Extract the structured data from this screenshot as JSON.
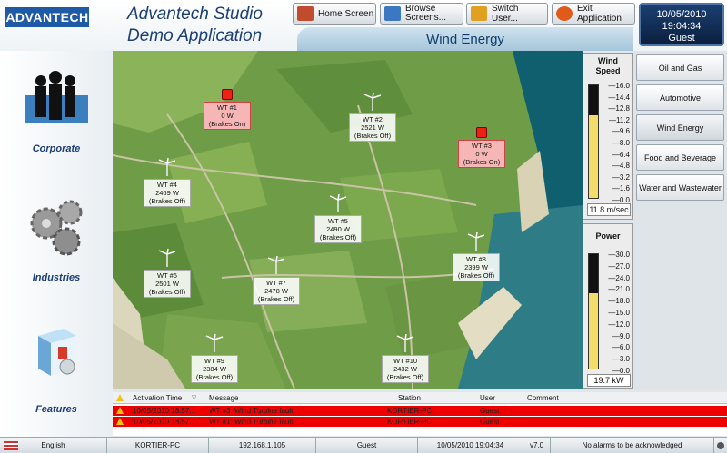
{
  "header": {
    "logo": "ADVANTECH",
    "title_line1": "Advantech Studio",
    "title_line2": "Demo Application",
    "buttons": [
      "Home Screen",
      "Browse Screens...",
      "Switch User...",
      "Exit Application"
    ],
    "screen_title": "Wind Energy",
    "date": "10/05/2010",
    "time": "19:04:34",
    "user": "Guest"
  },
  "left_nav": [
    {
      "label": "Corporate",
      "icon": "people-icon"
    },
    {
      "label": "Industries",
      "icon": "gears-icon"
    },
    {
      "label": "Features",
      "icon": "software-box-icon"
    }
  ],
  "turbines": [
    {
      "name": "WT #1",
      "power": "0 W",
      "state": "(Brakes On)",
      "fault": true
    },
    {
      "name": "WT #2",
      "power": "2521 W",
      "state": "(Brakes Off)",
      "fault": false
    },
    {
      "name": "WT #3",
      "power": "0 W",
      "state": "(Brakes On)",
      "fault": true
    },
    {
      "name": "WT #4",
      "power": "2469 W",
      "state": "(Brakes Off)",
      "fault": false
    },
    {
      "name": "WT #5",
      "power": "2490 W",
      "state": "(Brakes Off)",
      "fault": false
    },
    {
      "name": "WT #6",
      "power": "2501 W",
      "state": "(Brakes Off)",
      "fault": false
    },
    {
      "name": "WT #7",
      "power": "2478 W",
      "state": "(Brakes Off)",
      "fault": false
    },
    {
      "name": "WT #8",
      "power": "2399 W",
      "state": "(Brakes Off)",
      "fault": false
    },
    {
      "name": "WT #9",
      "power": "2384 W",
      "state": "(Brakes Off)",
      "fault": false
    },
    {
      "name": "WT #10",
      "power": "2432 W",
      "state": "(Brakes Off)",
      "fault": false
    }
  ],
  "wind_gauge": {
    "title_line1": "Wind",
    "title_line2": "Speed",
    "ticks": [
      "16.0",
      "14.4",
      "12.8",
      "11.2",
      "9.6",
      "8.0",
      "6.4",
      "4.8",
      "3.2",
      "1.6",
      "0.0"
    ],
    "value": 11.8,
    "max": 16,
    "value_text": "11.8 m/sec"
  },
  "power_gauge": {
    "title": "Power",
    "ticks": [
      "30.0",
      "27.0",
      "24.0",
      "21.0",
      "18.0",
      "15.0",
      "12.0",
      "9.0",
      "6.0",
      "3.0",
      "0.0"
    ],
    "value": 19.7,
    "max": 30,
    "value_text": "19.7 kW"
  },
  "industries": [
    "Oil and Gas",
    "Automotive",
    "Wind Energy",
    "Food and Beverage",
    "Water and Wastewater"
  ],
  "alarm_table": {
    "headers": [
      "Activation Time",
      "Message",
      "Station",
      "User",
      "Comment"
    ],
    "rows": [
      {
        "time": "10/05/2010 18:57...",
        "message": "WT #3: Wind Turbine fault.",
        "station": "KORTIER-PC",
        "user": "Guest",
        "comment": ""
      },
      {
        "time": "10/05/2010 18:57...",
        "message": "WT #1: Wind Turbine fault.",
        "station": "KORTIER-PC",
        "user": "Guest",
        "comment": ""
      }
    ]
  },
  "status_bar": {
    "language": "English",
    "station": "KORTIER-PC",
    "ip": "192.168.1.105",
    "user": "Guest",
    "datetime": "10/05/2010 19:04:34",
    "version": "v7.0",
    "alarm_msg": "No alarms to be acknowledged"
  },
  "colors": {
    "fault": "#ee0000",
    "gauge_fill": "#f4dc6a",
    "brand": "#1f5aa6"
  }
}
